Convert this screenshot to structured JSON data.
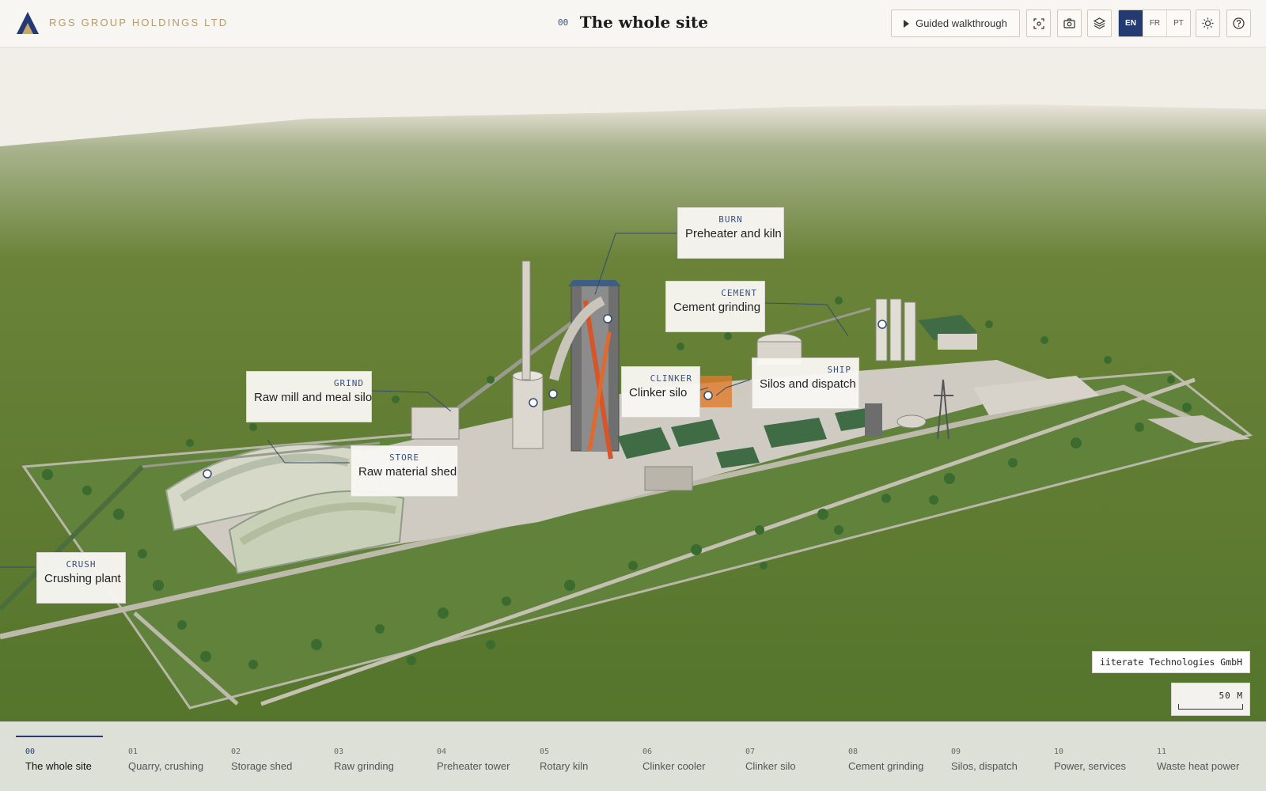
{
  "header": {
    "brand": "RGS GROUP HOLDINGS LTD",
    "title_number": "00",
    "title": "The whole site",
    "walkthrough_label": "Guided walkthrough",
    "languages": [
      "EN",
      "FR",
      "PT"
    ],
    "active_language": "EN",
    "icons": [
      "focus-icon",
      "camera-icon",
      "layers-icon",
      "sun-icon",
      "help-icon"
    ]
  },
  "callouts": [
    {
      "tag": "BURN",
      "name": "Preheater and kiln"
    },
    {
      "tag": "CEMENT",
      "name": "Cement grinding"
    },
    {
      "tag": "GRIND",
      "name": "Raw mill and meal silo"
    },
    {
      "tag": "CLINKER",
      "name": "Clinker silo"
    },
    {
      "tag": "SHIP",
      "name": "Silos and dispatch"
    },
    {
      "tag": "STORE",
      "name": "Raw material shed"
    },
    {
      "tag": "CRUSH",
      "name": "Crushing plant"
    }
  ],
  "credit": "iiterate Technologies GmbH",
  "scale": {
    "label": "50 M"
  },
  "chapters": [
    {
      "num": "00",
      "label": "The whole site"
    },
    {
      "num": "01",
      "label": "Quarry, crushing"
    },
    {
      "num": "02",
      "label": "Storage shed"
    },
    {
      "num": "03",
      "label": "Raw grinding"
    },
    {
      "num": "04",
      "label": "Preheater tower"
    },
    {
      "num": "05",
      "label": "Rotary kiln"
    },
    {
      "num": "06",
      "label": "Clinker cooler"
    },
    {
      "num": "07",
      "label": "Clinker silo"
    },
    {
      "num": "08",
      "label": "Cement grinding"
    },
    {
      "num": "09",
      "label": "Silos, dispatch"
    },
    {
      "num": "10",
      "label": "Power, services"
    },
    {
      "num": "11",
      "label": "Waste heat power"
    }
  ],
  "active_chapter": 0,
  "colors": {
    "accent": "#243a73",
    "brand": "#b39a6b",
    "grass": "#5b7a31"
  }
}
